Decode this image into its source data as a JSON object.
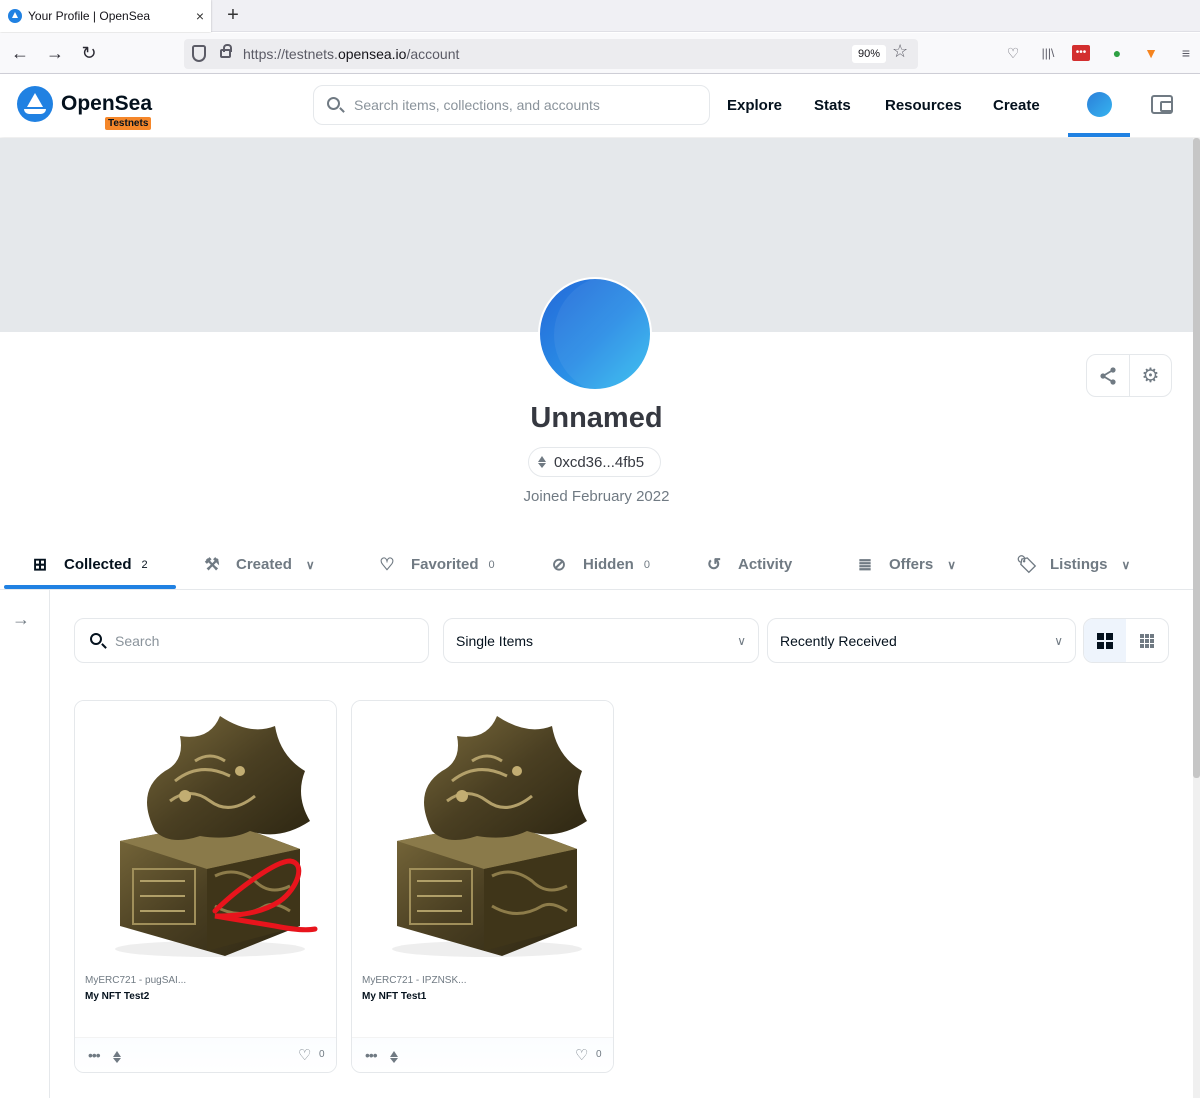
{
  "browser": {
    "tab_title": "Your Profile | OpenSea",
    "tab_close": "×",
    "new_tab": "+",
    "url_prefix": "https://testnets.",
    "url_domain": "opensea.io",
    "url_path": "/account",
    "zoom": "90%"
  },
  "header": {
    "logo_text": "OpenSea",
    "badge": "Testnets",
    "search_placeholder": "Search items, collections, and accounts",
    "nav": [
      "Explore",
      "Stats",
      "Resources",
      "Create"
    ]
  },
  "profile": {
    "name": "Unnamed",
    "address": "0xcd36...4fb5",
    "joined": "Joined February 2022"
  },
  "tabs": [
    {
      "label": "Collected",
      "count": "2"
    },
    {
      "label": "Created"
    },
    {
      "label": "Favorited",
      "count": "0"
    },
    {
      "label": "Hidden",
      "count": "0"
    },
    {
      "label": "Activity"
    },
    {
      "label": "Offers"
    },
    {
      "label": "Listings"
    }
  ],
  "filters": {
    "search_placeholder": "Search",
    "type_select": "Single Items",
    "sort_select": "Recently Received"
  },
  "items": [
    {
      "collection": "MyERC721 - pugSAI...",
      "name": "My NFT Test2",
      "likes": "0",
      "annotation": "2"
    },
    {
      "collection": "MyERC721 - IPZNSK...",
      "name": "My NFT Test1",
      "likes": "0"
    }
  ],
  "colors": {
    "accent": "#2081e2",
    "badge": "#f5872a",
    "annotation": "#e8141c"
  }
}
